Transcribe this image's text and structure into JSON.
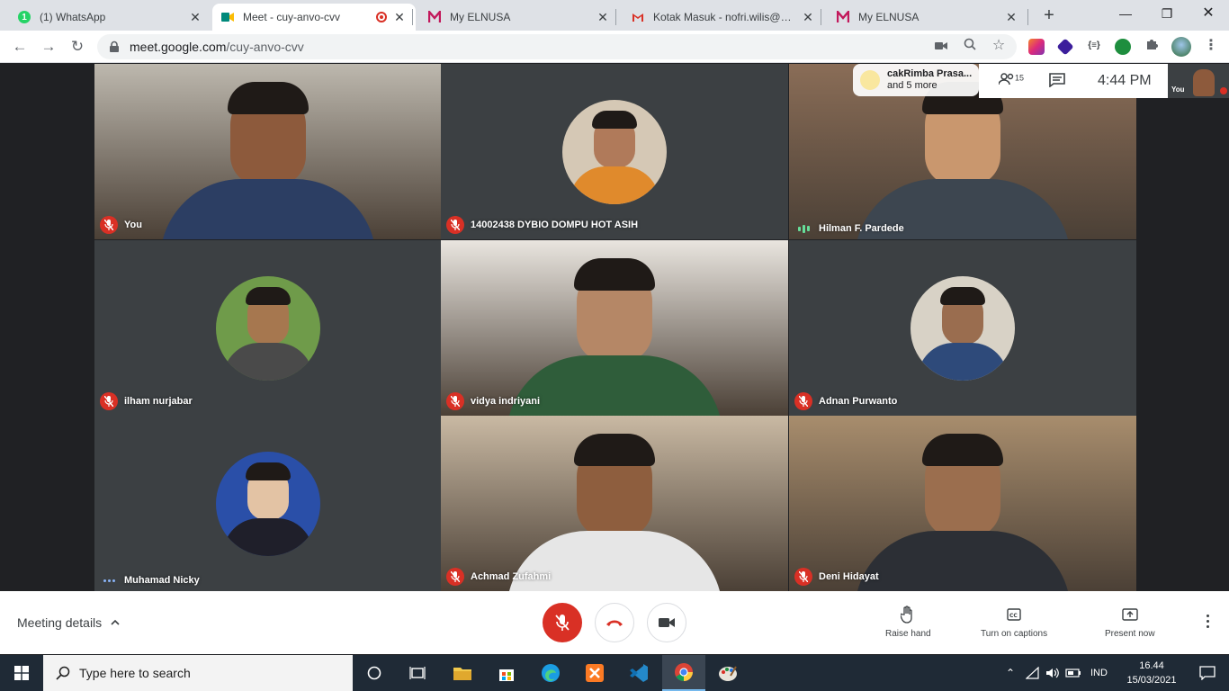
{
  "browser": {
    "tabs": [
      {
        "title": "(1) WhatsApp",
        "favicon": "whatsapp-icon",
        "color": "#25d366",
        "badge": "1"
      },
      {
        "title": "Meet - cuy-anvo-cvv",
        "favicon": "google-meet-icon",
        "color": "#00897b",
        "active": true,
        "recording": true
      },
      {
        "title": "My ELNUSA",
        "favicon": "elnusa-icon",
        "color": "#c2185b"
      },
      {
        "title": "Kotak Masuk - nofri.wilis@gma",
        "favicon": "gmail-icon",
        "color": "#d93025"
      },
      {
        "title": "My ELNUSA",
        "favicon": "elnusa-icon",
        "color": "#c2185b"
      }
    ],
    "url_host": "meet.google.com",
    "url_path": "/cuy-anvo-cvv",
    "extension_label": "{≡}"
  },
  "meet": {
    "participants": [
      {
        "name": "You",
        "mic": "off",
        "kind": "video",
        "bg": "#bdb8ae",
        "skin": "#8d5a3c",
        "shirt": "#2c3e63"
      },
      {
        "name": "14002438 DYBIO DOMPU HOT ASIH",
        "mic": "off",
        "kind": "avatar",
        "bg": "#d5c8b5",
        "skin": "#b07a5a",
        "shirt": "#e08a2c"
      },
      {
        "name": "Hilman F. Pardede",
        "mic": "speaking",
        "kind": "video",
        "bg": "#8a6d57",
        "skin": "#c9976e",
        "shirt": "#3d4650"
      },
      {
        "name": "ilham nurjabar",
        "mic": "off",
        "kind": "avatar",
        "bg": "#6f9b4a",
        "skin": "#a6774f",
        "shirt": "#4a4a4a"
      },
      {
        "name": "vidya indriyani",
        "mic": "off",
        "kind": "video",
        "bg": "#e9e5df",
        "skin": "#b58766",
        "shirt": "#2f5d3a"
      },
      {
        "name": "Adnan Purwanto",
        "mic": "off",
        "kind": "avatar",
        "bg": "#d8d2c6",
        "skin": "#9a6d4f",
        "shirt": "#2e4a7a"
      },
      {
        "name": "Muhamad Nicky",
        "mic": "dots",
        "kind": "avatar",
        "bg": "#2a4fa8",
        "skin": "#e3c3a4",
        "shirt": "#1f1f2a"
      },
      {
        "name": "Achmad Zufahmi",
        "mic": "off",
        "kind": "video",
        "bg": "#c9b9a3",
        "skin": "#8e5e3e",
        "shirt": "#e6e6e6"
      },
      {
        "name": "Deni Hidayat",
        "mic": "off",
        "kind": "video",
        "bg": "#a88d6d",
        "skin": "#9b6e4e",
        "shirt": "#2c2f35"
      }
    ],
    "others_label_line1": "cakRimba Prasa...",
    "others_label_line2": "and 5 more",
    "participant_count": "15",
    "time": "4:44 PM",
    "self_thumb_label": "You"
  },
  "controls": {
    "meeting_details": "Meeting details",
    "raise_hand": "Raise hand",
    "captions": "Turn on captions",
    "present": "Present now"
  },
  "taskbar": {
    "search_placeholder": "Type here to search",
    "language": "IND",
    "clock_time": "16.44",
    "clock_date": "15/03/2021"
  }
}
